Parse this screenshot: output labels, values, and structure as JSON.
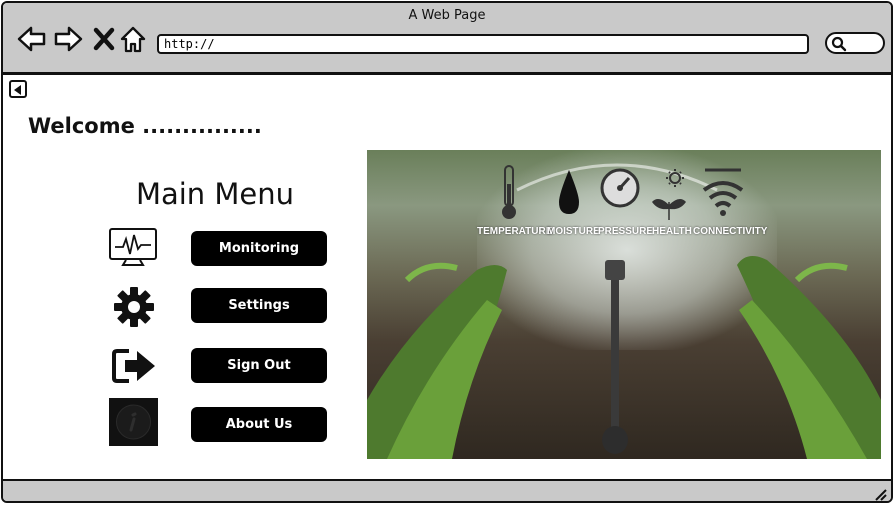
{
  "window": {
    "title": "A Web Page",
    "url": "http://"
  },
  "toolbar_icons": [
    "back-arrow-icon",
    "forward-arrow-icon",
    "close-x-icon",
    "home-icon"
  ],
  "welcome_text": "Welcome ...............",
  "menu": {
    "title": "Main Menu",
    "items": [
      {
        "label": "Monitoring",
        "icon": "monitor-pulse-icon"
      },
      {
        "label": "Settings",
        "icon": "gear-icon"
      },
      {
        "label": "Sign Out",
        "icon": "sign-out-icon"
      },
      {
        "label": "About Us",
        "icon": "info-icon"
      }
    ]
  },
  "hero": {
    "sensors": [
      {
        "label": "TEMPERATURE",
        "icon": "thermometer-icon"
      },
      {
        "label": "MOISTURE",
        "icon": "water-drop-icon"
      },
      {
        "label": "PRESSURE",
        "icon": "gauge-icon"
      },
      {
        "label": "HEALTH",
        "icon": "plant-sun-icon"
      },
      {
        "label": "CONNECTIVITY",
        "icon": "wifi-icon"
      }
    ]
  }
}
